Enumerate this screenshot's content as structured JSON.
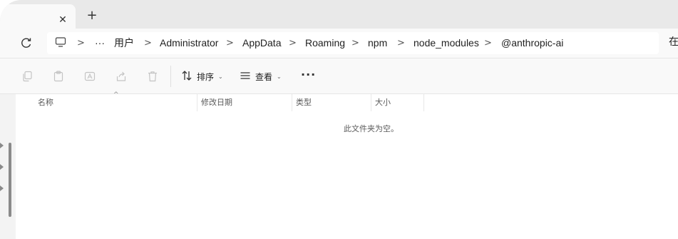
{
  "tabs": {
    "close_glyph": "✕",
    "new_tab_glyph": "+"
  },
  "address": {
    "overflow": "···",
    "crumbs": [
      "用户",
      "Administrator",
      "AppData",
      "Roaming",
      "npm",
      "node_modules",
      "@anthropic-ai"
    ],
    "search_fragment": "在"
  },
  "commands": {
    "sort_label": "排序",
    "view_label": "查看",
    "more_label": "···"
  },
  "columns": [
    "名称",
    "修改日期",
    "类型",
    "大小"
  ],
  "empty_message": "此文件夹为空。",
  "colors": {
    "accent": "#8a8a8a",
    "background": "#f3f3f3",
    "surface": "#ffffff"
  }
}
